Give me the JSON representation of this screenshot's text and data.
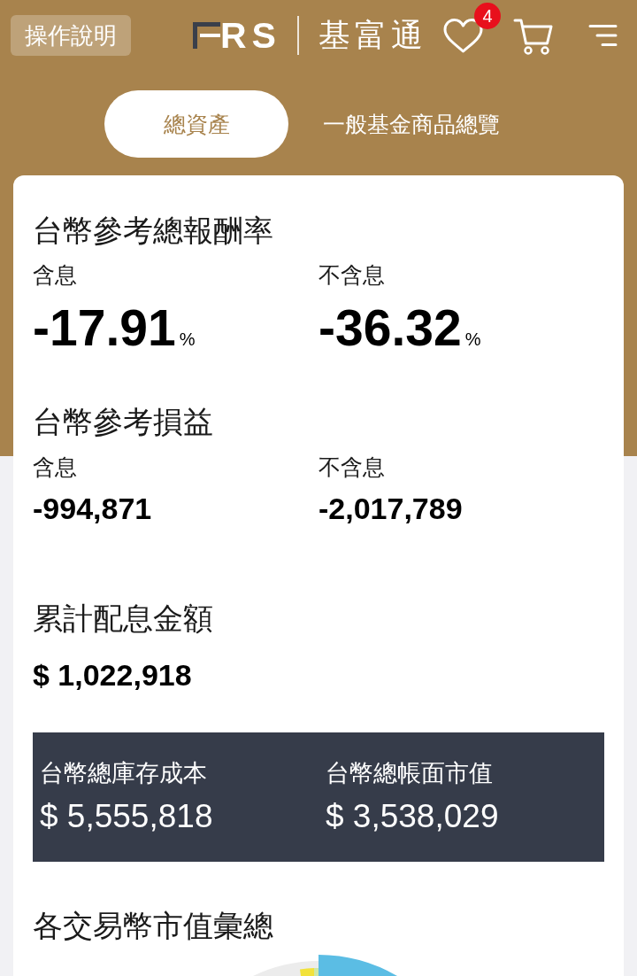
{
  "header": {
    "help_button": "操作說明",
    "logo": {
      "mark_text": "RS",
      "name": "基富通"
    },
    "favorites_badge": "4"
  },
  "tabs": [
    {
      "label": "總資產",
      "selected": true
    },
    {
      "label": "一般基金商品總覽",
      "selected": false
    }
  ],
  "sections": [
    {
      "kind": "rates",
      "title": "台幣參考總報酬率",
      "items": [
        {
          "label": "含息",
          "value": "-17.91",
          "unit": "%"
        },
        {
          "label": "不含息",
          "value": "-36.32",
          "unit": "%"
        }
      ]
    },
    {
      "kind": "amounts",
      "title": "台幣參考損益",
      "items": [
        {
          "label": "含息",
          "value": "-994,871"
        },
        {
          "label": "不含息",
          "value": "-2,017,789"
        }
      ]
    },
    {
      "kind": "total",
      "title": "累計配息金額",
      "value": "$ 1,022,918"
    },
    {
      "kind": "summary",
      "items": [
        {
          "label": "台幣總庫存成本",
          "value": "$ 5,555,818"
        },
        {
          "label": "台幣總帳面市值",
          "value": "$ 3,538,029"
        }
      ]
    },
    {
      "kind": "chart",
      "title": "各交易幣市值彙總"
    }
  ]
}
